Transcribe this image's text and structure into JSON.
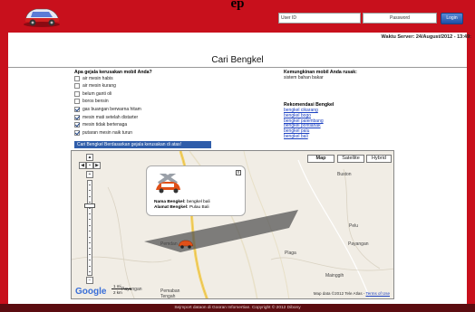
{
  "page_heading": "ep",
  "header": {
    "user_id_label": "User ID",
    "password_label": "Password",
    "login_label": "Login",
    "colors": {
      "header_bg": "#c8101c",
      "footer_bg": "#5b0c10",
      "button_bg": "#2f5daa"
    }
  },
  "server_time": "Waktu Server: 24/August/2012 - 13:49:",
  "page_title": "Cari Bengkel",
  "symptoms": {
    "heading": "Apa gejala kerusakan mobil Anda?",
    "items": [
      {
        "label": "air mesin habis",
        "checked": false
      },
      {
        "label": "air mesin kurang",
        "checked": false
      },
      {
        "label": "belum ganti oli",
        "checked": false
      },
      {
        "label": "boros bensin",
        "checked": false
      },
      {
        "label": "gas buangan berwarna hitam",
        "checked": true
      },
      {
        "label": "mesin mati setelah distarter",
        "checked": true
      },
      {
        "label": "mesin tidak bertenaga",
        "checked": true
      },
      {
        "label": "putaran mesin naik turun",
        "checked": true
      }
    ],
    "search_button": "Cari Bengkel Berdasarkan gejala kerusakan di atas!"
  },
  "diagnosis": {
    "heading": "Kemungkinan mobil Anda rusak:",
    "value": "sistem bahan bakar"
  },
  "recommendations": {
    "heading": "Rekomendasi Bengkel",
    "links": [
      "bengkel cikarang",
      "bengkel bogo",
      "bengkel palembang",
      "bengkel pontianak",
      "bengkel palu",
      "bengkel bali"
    ]
  },
  "map": {
    "types": [
      "Map",
      "Satellite",
      "Hybrid"
    ],
    "active_type": "Map",
    "towns": [
      "Buston",
      "Pelu",
      "Payangan",
      "Pemdan",
      "Plaga",
      "Mainggih",
      "Pemaban",
      "Tengah",
      "Payangan"
    ],
    "bubble": {
      "close": "x",
      "name_label": "Nama Bengkel:",
      "name_value": "bengkel bali",
      "address_label": "Alamat Bengkel:",
      "address_value": "Pulau Bali"
    },
    "scale_mi": "1 mi",
    "scale_km": "2 km",
    "google_label": "Google",
    "attribution": "Map data ©2012 Tele Atlas - ",
    "terms_label": "Terms of Use"
  },
  "footer": "Sejmport dataon di Gooran Infomertian. Copyright © 2012 Dibony"
}
